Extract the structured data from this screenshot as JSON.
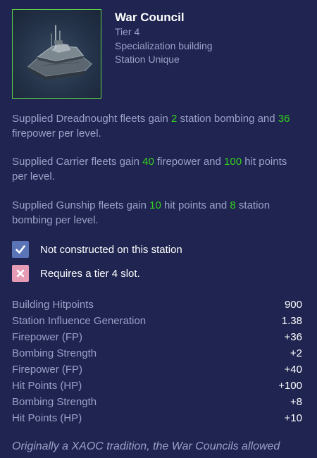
{
  "building": {
    "name": "War Council",
    "tier": "Tier 4",
    "type": "Specialization building",
    "uniqueness": "Station Unique"
  },
  "descriptions": [
    {
      "parts": [
        "Supplied Dreadnought fleets gain ",
        "2",
        " station bombing and ",
        "36",
        " firepower per level."
      ]
    },
    {
      "parts": [
        "Supplied Carrier fleets gain ",
        "40",
        " firepower and ",
        "100",
        " hit points per level."
      ]
    },
    {
      "parts": [
        "Supplied Gunship fleets gain ",
        "10",
        " hit points and ",
        "8",
        " station bombing per level."
      ]
    }
  ],
  "requirements": [
    {
      "text": "Not constructed on this station",
      "status": "met",
      "icon": "checkmark-icon"
    },
    {
      "text": "Requires a tier 4 slot.",
      "status": "unmet",
      "icon": "x-icon"
    }
  ],
  "stats": [
    {
      "label": "Building Hitpoints",
      "value": "900"
    },
    {
      "label": "Station Influence Generation",
      "value": "1.38"
    },
    {
      "label": "Firepower (FP)",
      "value": "+36"
    },
    {
      "label": "Bombing Strength",
      "value": "+2"
    },
    {
      "label": "Firepower (FP)",
      "value": "+40"
    },
    {
      "label": "Hit Points (HP)",
      "value": "+100"
    },
    {
      "label": "Bombing Strength",
      "value": "+8"
    },
    {
      "label": "Hit Points (HP)",
      "value": "+10"
    }
  ],
  "lore": "Originally a XAOC tradition, the War Councils allowed",
  "colors": {
    "background": "#1f2450",
    "highlight_green": "#35d11f",
    "thumbnail_border": "#5fcf4a",
    "check_box": "#5a74b8",
    "x_box": "#e59bb3"
  }
}
